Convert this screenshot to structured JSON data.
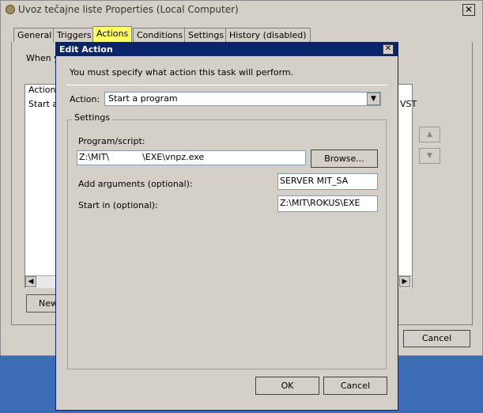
{
  "outer": {
    "title": "Uvoz tečajne liste Properties (Local Computer)",
    "close_glyph": "✕",
    "tabs": [
      {
        "label": "General"
      },
      {
        "label": "Triggers"
      },
      {
        "label": "Actions"
      },
      {
        "label": "Conditions"
      },
      {
        "label": "Settings"
      },
      {
        "label": "History (disabled)"
      }
    ],
    "when_text": "When y",
    "list_header_action": "Action",
    "list_header_details": "VST",
    "list_row_action": "Start a",
    "new_label": "New",
    "cancel_label": "Cancel"
  },
  "dialog": {
    "title": "Edit Action",
    "close_glyph": "✕",
    "instruction": "You must specify what action this task will perform.",
    "action_label": "Action:",
    "action_value": "Start a program",
    "settings_label": "Settings",
    "program_label": "Program/script:",
    "program_value": "Z:\\MIT\\            \\EXE\\vnpz.exe",
    "browse_label": "Browse...",
    "args_label": "Add arguments (optional):",
    "args_value": "SERVER MIT_SA",
    "startin_label": "Start in (optional):",
    "startin_value": "Z:\\MIT\\ROKUS\\EXE",
    "ok_label": "OK",
    "cancel_label": "Cancel"
  },
  "colors": {
    "dialog_titlebar": "#0a246a",
    "active_tab_highlight": "#ffff66",
    "window_bg": "#d4d0c8",
    "desktop": "#3b6cb5"
  }
}
